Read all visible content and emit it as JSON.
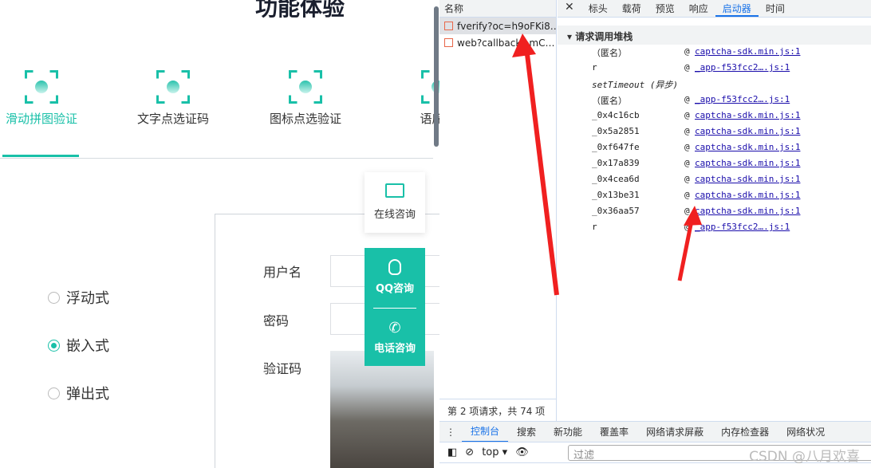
{
  "page": {
    "title": "功能体验",
    "tabs": [
      {
        "label": "滑动拼图验证",
        "active": true
      },
      {
        "label": "文字点选证码"
      },
      {
        "label": "图标点选验证"
      },
      {
        "label": "语序点"
      }
    ],
    "modes": [
      {
        "label": "浮动式",
        "checked": false
      },
      {
        "label": "嵌入式",
        "checked": true
      },
      {
        "label": "弹出式",
        "checked": false
      }
    ],
    "form": {
      "username": "用户名",
      "password": "密码",
      "captcha": "验证码"
    },
    "float": {
      "online": "在线咨询",
      "qq": "QQ咨询",
      "phone": "电话咨询"
    },
    "accent": "#19c0a8"
  },
  "devtools": {
    "name_header": "名称",
    "requests": [
      "fverify?oc=h9oFKi8…",
      "web?callback=mC…"
    ],
    "status": "第 2 项请求，共 74 项",
    "detail_tabs": [
      "标头",
      "载荷",
      "预览",
      "响应",
      "启动器",
      "时间"
    ],
    "active_tab": "启动器",
    "section": "请求调用堆栈",
    "stack": [
      {
        "fn": "（匿名）",
        "src": "captcha-sdk.min.js:1"
      },
      {
        "fn": "r",
        "src": "_app-f53fcc2….js:1"
      },
      {
        "fn": "setTimeout (异步)",
        "src": ""
      },
      {
        "fn": "（匿名）",
        "src": "_app-f53fcc2….js:1"
      },
      {
        "fn": "_0x4c16cb",
        "src": "captcha-sdk.min.js:1"
      },
      {
        "fn": "_0x5a2851",
        "src": "captcha-sdk.min.js:1"
      },
      {
        "fn": "_0xf647fe",
        "src": "captcha-sdk.min.js:1"
      },
      {
        "fn": "_0x17a839",
        "src": "captcha-sdk.min.js:1"
      },
      {
        "fn": "_0x4cea6d",
        "src": "captcha-sdk.min.js:1"
      },
      {
        "fn": "_0x13be31",
        "src": "captcha-sdk.min.js:1"
      },
      {
        "fn": "_0x36aa57",
        "src": "captcha-sdk.min.js:1"
      },
      {
        "fn": "r",
        "src": "_app-f53fcc2….js:1"
      }
    ],
    "drawer_tabs": [
      "控制台",
      "搜索",
      "新功能",
      "覆盖率",
      "网络请求屏蔽",
      "内存检查器",
      "网络状况"
    ],
    "context": "top",
    "filter_placeholder": "过滤"
  },
  "watermark": "CSDN @八月欢喜"
}
